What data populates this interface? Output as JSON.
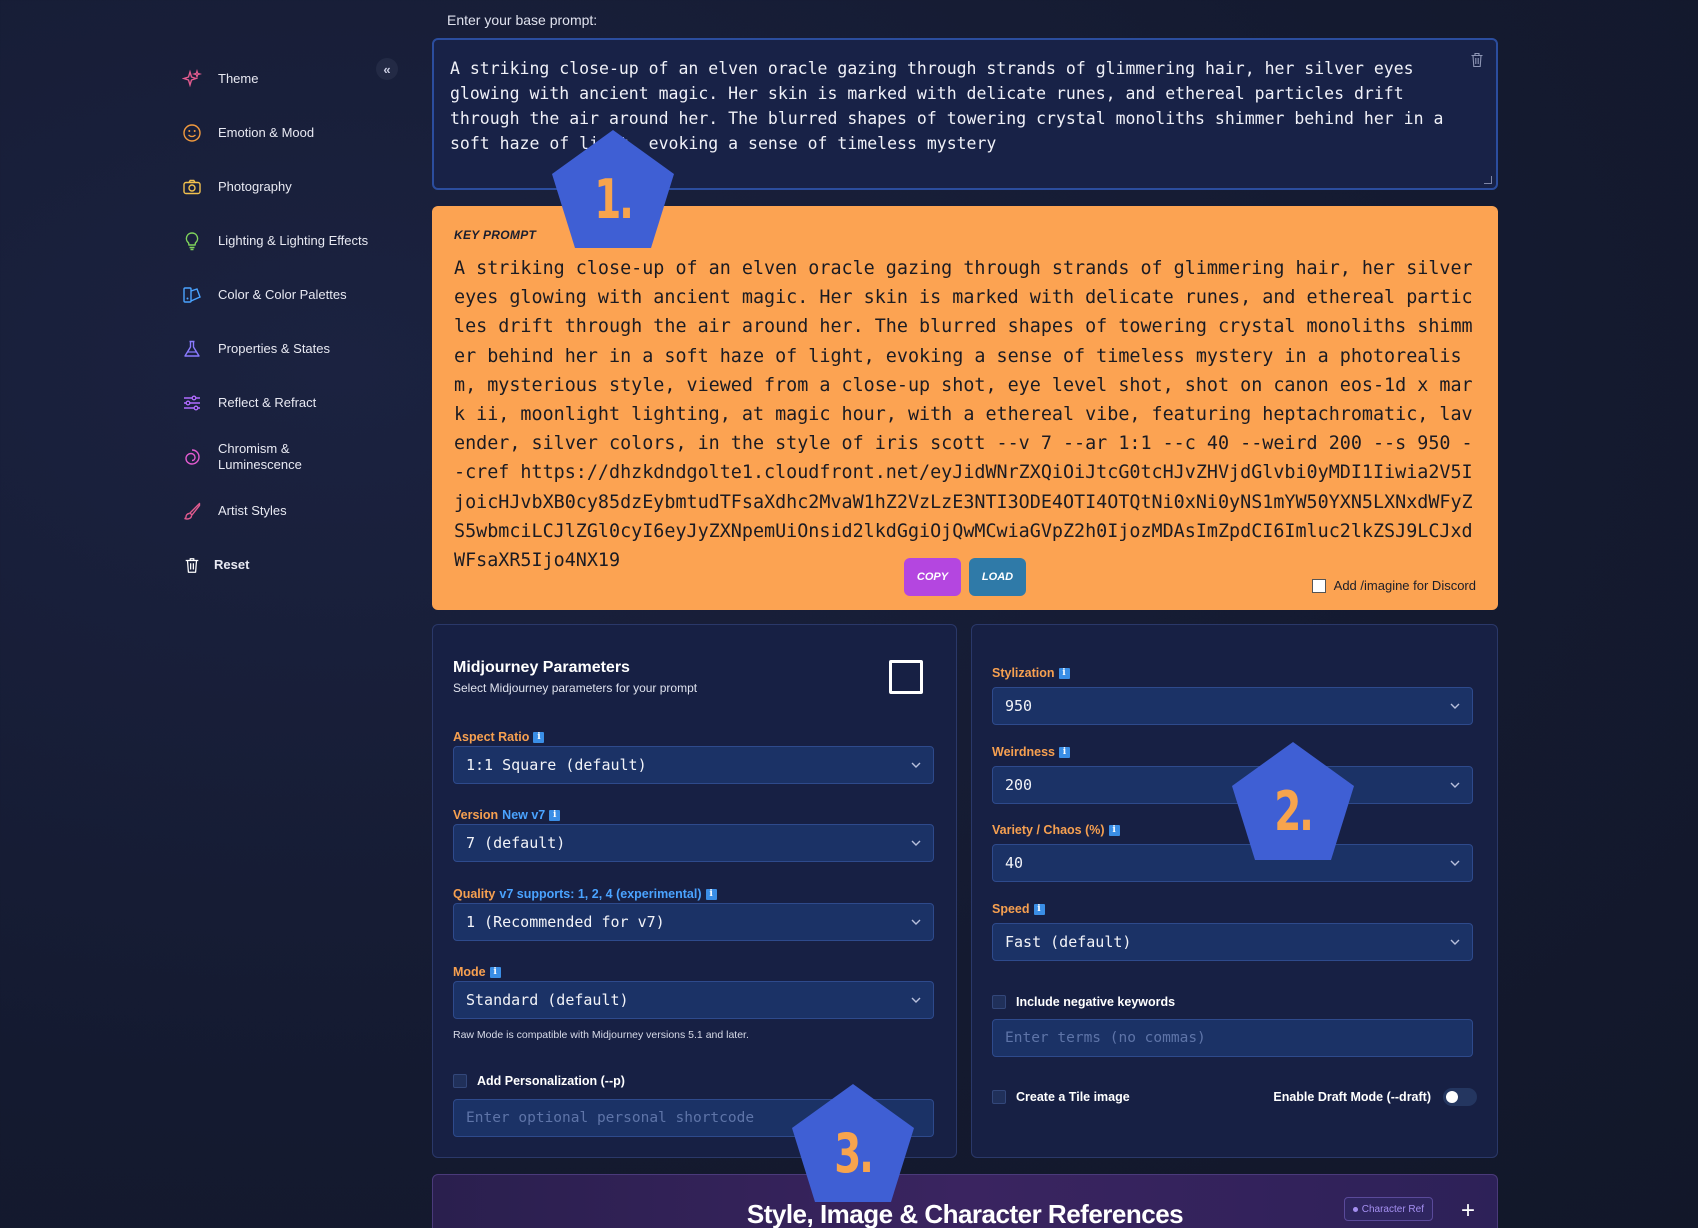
{
  "sidebar": {
    "collapse_label": "«",
    "items": [
      {
        "label": "Theme",
        "icon": "sparkles-icon",
        "color": "#e35b8f"
      },
      {
        "label": "Emotion & Mood",
        "icon": "smiley-icon",
        "color": "#f19a3e"
      },
      {
        "label": "Photography",
        "icon": "camera-icon",
        "color": "#f2c14e"
      },
      {
        "label": "Lighting & Lighting Effects",
        "icon": "lightbulb-icon",
        "color": "#7fd35b"
      },
      {
        "label": "Color & Color Palettes",
        "icon": "palette-icon",
        "color": "#4aa3ff"
      },
      {
        "label": "Properties & States",
        "icon": "flask-icon",
        "color": "#8a7bff"
      },
      {
        "label": "Reflect & Refract",
        "icon": "sliders-icon",
        "color": "#b06bff"
      },
      {
        "label": "Chromism & Luminescence",
        "icon": "swirl-icon",
        "color": "#e35bd0"
      },
      {
        "label": "Artist Styles",
        "icon": "brush-icon",
        "color": "#e35b8f"
      },
      {
        "label": "Reset",
        "icon": "trash-icon",
        "color": "#ffffff"
      }
    ]
  },
  "base_prompt": {
    "label": "Enter your base prompt:",
    "value": "A striking close-up of an elven oracle gazing through strands of glimmering hair, her silver eyes glowing with ancient magic. Her skin is marked with delicate runes, and ethereal particles drift through the air around her. The blurred shapes of towering crystal monoliths shimmer behind her in a soft haze of light, evoking a sense of timeless mystery"
  },
  "key_prompt": {
    "label": "KEY PROMPT",
    "text": "A striking close-up of an elven oracle gazing through strands of glimmering hair, her silver eyes glowing with ancient magic. Her skin is marked with delicate runes, and ethereal particles drift through the air around her. The blurred shapes of towering crystal monoliths shimmer behind her in a soft haze of light, evoking a sense of timeless mystery in a photorealism, mysterious style, viewed from a close-up shot, eye level shot, shot on canon eos-1d x mark ii, moonlight lighting, at magic hour, with a ethereal vibe, featuring heptachromatic, lavender, silver colors, in the style of iris scott --v 7 --ar 1:1 --c 40 --weird 200 --s 950 --cref https://dhzkdndgolte1.cloudfront.net/eyJidWNrZXQiOiJtcG0tcHJvZHVjdGlvbi0yMDI1Iiwia2V5IjoicHJvbXB0cy85dzEybmtudTFsaXdhc2MvaW1hZ2VzLzE3NTI3ODE4OTI4OTQtNi0xNi0yNS1mYW50YXN5LXNxdWFyZS5wbmciLCJlZGl0cyI6eyJyZXNpemUiOnsid2lkdGgiOjQwMCwiaGVpZ2h0IjozMDAsImZpdCI6Imluc2lkZSJ9LCJxdWFsaXR5Ijo4NX19",
    "copy_label": "COPY",
    "load_label": "LOAD",
    "discord_label": "Add /imagine for Discord"
  },
  "params_left": {
    "title": "Midjourney Parameters",
    "subtitle": "Select Midjourney parameters for your prompt",
    "aspect_label": "Aspect Ratio",
    "aspect_value": "1:1 Square (default)",
    "version_label": "Version",
    "version_note": "New v7",
    "version_value": "7 (default)",
    "quality_label": "Quality",
    "quality_note": "v7 supports: 1, 2, 4 (experimental)",
    "quality_value": "1 (Recommended for v7)",
    "mode_label": "Mode",
    "mode_value": "Standard (default)",
    "mode_note": "Raw Mode is compatible with Midjourney versions 5.1 and later.",
    "personalization_label": "Add Personalization (--p)",
    "personalization_placeholder": "Enter optional personal shortcode"
  },
  "params_right": {
    "stylization_label": "Stylization",
    "stylization_value": "950",
    "weirdness_label": "Weirdness",
    "weirdness_value": "200",
    "chaos_label": "Variety / Chaos (%)",
    "chaos_value": "40",
    "speed_label": "Speed",
    "speed_value": "Fast (default)",
    "negative_label": "Include negative keywords",
    "negative_placeholder": "Enter terms (no commas)",
    "tile_label": "Create a Tile image",
    "draft_label": "Enable Draft Mode (--draft)"
  },
  "references": {
    "title": "Style, Image & Character References",
    "badge": "Character Ref",
    "add_label": "+"
  },
  "markers": [
    "1.",
    "2.",
    "3."
  ],
  "colors": {
    "background": "#161c33",
    "key_prompt_bg": "#fca352",
    "accent_orange": "#f7a050",
    "accent_blue": "#4aa3ff",
    "marker_blue": "#3f5fd4"
  }
}
